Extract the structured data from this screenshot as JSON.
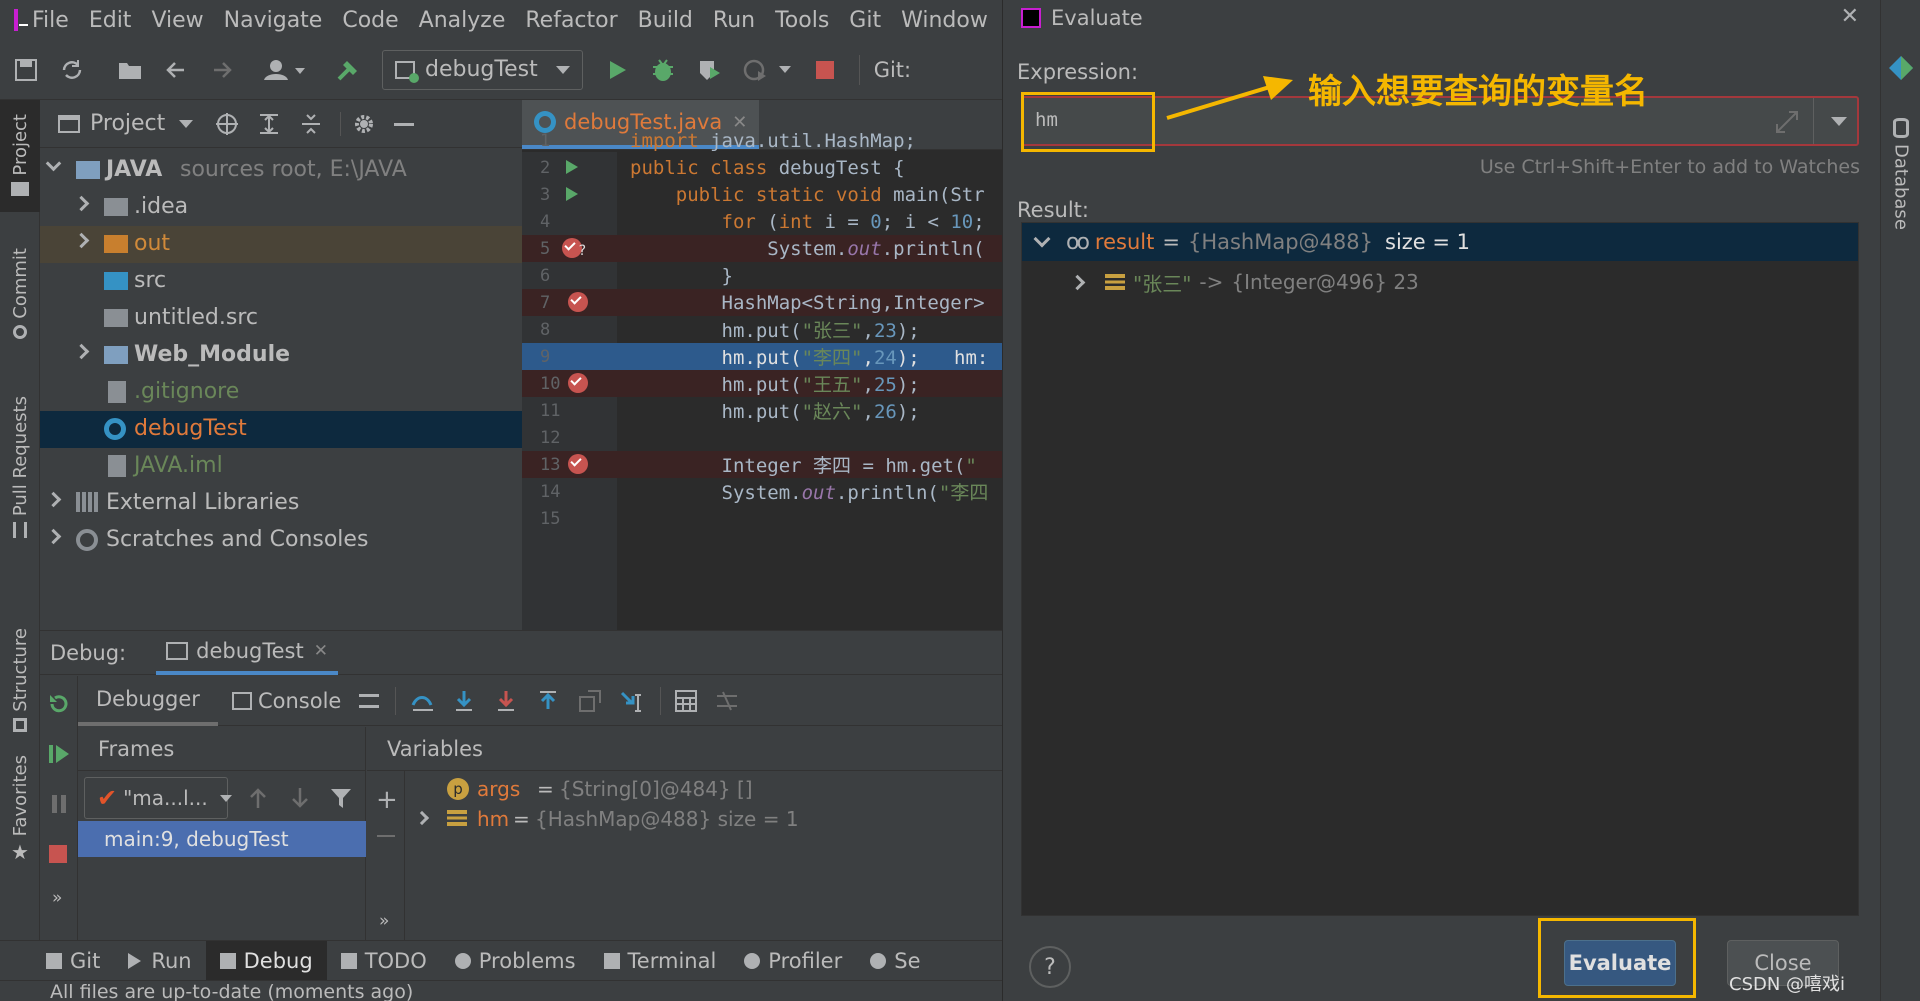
{
  "menu": [
    "File",
    "Edit",
    "View",
    "Navigate",
    "Code",
    "Analyze",
    "Refactor",
    "Build",
    "Run",
    "Tools",
    "Git",
    "Window"
  ],
  "toolbar": {
    "run_config": "debugTest",
    "git_label": "Git:"
  },
  "left_tabs": [
    "Project",
    "Commit",
    "Pull Requests",
    "Structure",
    "Favorites"
  ],
  "project": {
    "title": "Project",
    "tree": [
      {
        "label": "JAVA",
        "suffix": "sources root,  E:\\JAVA",
        "icon": "module-folder-icon",
        "depth": 0,
        "arrow": "down",
        "bold": true,
        "color": "#bbbbbb"
      },
      {
        "label": ".idea",
        "icon": "folder-icon",
        "depth": 1,
        "arrow": "right",
        "color": "#bbbbbb"
      },
      {
        "label": "out",
        "icon": "excluded-folder-icon",
        "depth": 1,
        "arrow": "right",
        "color": "#d08a3a"
      },
      {
        "label": "src",
        "icon": "source-folder-icon",
        "depth": 1,
        "arrow": "",
        "color": "#bbbbbb"
      },
      {
        "label": "untitled.src",
        "icon": "folder-icon",
        "depth": 1,
        "arrow": "",
        "color": "#bbbbbb"
      },
      {
        "label": "Web_Module",
        "icon": "module-folder-icon",
        "depth": 1,
        "arrow": "right",
        "bold": true,
        "color": "#bbbbbb"
      },
      {
        "label": ".gitignore",
        "icon": "gitignore-file-icon",
        "depth": 1,
        "arrow": "",
        "color": "#6a8759"
      },
      {
        "label": "debugTest",
        "icon": "java-class-icon",
        "depth": 1,
        "arrow": "",
        "color": "#e07a3b",
        "selected": true
      },
      {
        "label": "JAVA.iml",
        "icon": "iml-file-icon",
        "depth": 1,
        "arrow": "",
        "color": "#6a8759"
      },
      {
        "label": "External Libraries",
        "icon": "libraries-icon",
        "depth": 0,
        "arrow": "right",
        "color": "#bbbbbb"
      },
      {
        "label": "Scratches and Consoles",
        "icon": "scratches-icon",
        "depth": 0,
        "arrow": "right",
        "color": "#bbbbbb"
      }
    ]
  },
  "editor": {
    "tab": "debugTest.java",
    "lines": [
      {
        "n": "1",
        "code": "import java.util.HashMap;"
      },
      {
        "n": "2",
        "code": "public class debugTest {",
        "run": true
      },
      {
        "n": "3",
        "code": "    public static void main(Str",
        "run": true
      },
      {
        "n": "4",
        "code": "        for (int i = 0; i < 10;"
      },
      {
        "n": "5",
        "code": "            System.out.println(",
        "bp": "conditional"
      },
      {
        "n": "6",
        "code": "        }"
      },
      {
        "n": "7",
        "code": "        HashMap<String,Integer>",
        "bp": "check"
      },
      {
        "n": "8",
        "code": "        hm.put(\"张三\",23);"
      },
      {
        "n": "9",
        "code": "        hm.put(\"李四\",24);   hm:",
        "current": true
      },
      {
        "n": "10",
        "code": "        hm.put(\"王五\",25);",
        "bp": "check"
      },
      {
        "n": "11",
        "code": "        hm.put(\"赵六\",26);"
      },
      {
        "n": "12",
        "code": ""
      },
      {
        "n": "13",
        "code": "        Integer 李四 = hm.get(\"",
        "bp": "check"
      },
      {
        "n": "14",
        "code": "        System.out.println(\"李四"
      },
      {
        "n": "15",
        "code": ""
      }
    ]
  },
  "debug": {
    "label": "Debug:",
    "session": "debugTest",
    "tabs": [
      "Debugger",
      "Console"
    ],
    "frames_title": "Frames",
    "thread": "\"ma...l...",
    "frame": "main:9, debugTest",
    "variables_title": "Variables",
    "variables": [
      {
        "name": "args",
        "eq": "=",
        "value": "{String[0]@484} []",
        "icon": "parameter-icon"
      },
      {
        "name": "hm",
        "eq": "=",
        "value": "{HashMap@488}  size = 1",
        "icon": "field-icon",
        "expandable": true
      }
    ]
  },
  "bottom_tabs": [
    "Git",
    "Run",
    "Debug",
    "TODO",
    "Problems",
    "Terminal",
    "Profiler",
    "Se"
  ],
  "status": "All files are up-to-date (moments ago)",
  "dialog": {
    "title": "Evaluate",
    "expression_label": "Expression:",
    "expression_value": "hm",
    "annotation": "输入想要查询的变量名",
    "watch_hint": "Use Ctrl+Shift+Enter to add to Watches",
    "result_label": "Result:",
    "result": {
      "name": "result",
      "eq": "=",
      "value": "{HashMap@488}",
      "size": "size = 1"
    },
    "entry": {
      "key": "\"张三\"",
      "arrow": "->",
      "value": "{Integer@496} 23"
    },
    "help": "?",
    "evaluate_button": "Evaluate",
    "close_button": "Close",
    "watermark": "CSDN @嘻戏i"
  },
  "right_tabs": [
    "Database"
  ],
  "colors": {
    "accent": "#4a88c7",
    "annotation": "#f5b700",
    "breakpoint": "#c75450",
    "selection": "#0d293e"
  }
}
